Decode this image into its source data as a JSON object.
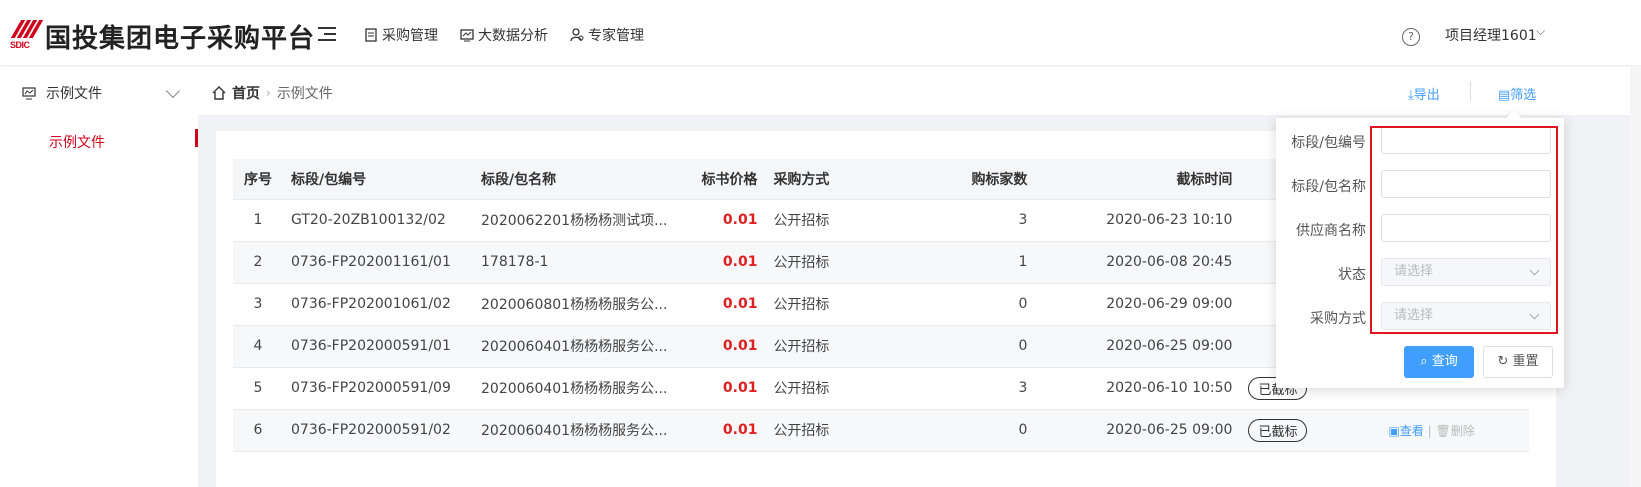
{
  "app": {
    "title": "国投集团电子采购平台",
    "logo_text": "SDIC"
  },
  "nav": [
    {
      "label": "采购管理",
      "icon": "document-icon"
    },
    {
      "label": "大数据分析",
      "icon": "chart-icon"
    },
    {
      "label": "专家管理",
      "icon": "people-icon"
    }
  ],
  "header": {
    "help": "?",
    "user": "项目经理1601"
  },
  "sidebar": {
    "group": "示例文件",
    "items": [
      {
        "label": "示例文件"
      }
    ]
  },
  "breadcrumb": {
    "home": "首页",
    "current": "示例文件"
  },
  "actions": {
    "export": "导出",
    "filter": "筛选"
  },
  "table": {
    "columns": [
      "序号",
      "标段/包编号",
      "标段/包名称",
      "标书价格",
      "采购方式",
      "购标家数",
      "截标时间"
    ],
    "rows": [
      {
        "no": "1",
        "code": "GT20-20ZB100132/02",
        "name": "2020062201杨杨杨测试项...",
        "price": "0.01",
        "method": "公开招标",
        "count": "3",
        "deadline": "2020-06-23 10:10",
        "status": "",
        "view": "",
        "del": ""
      },
      {
        "no": "2",
        "code": "0736-FP202001161/01",
        "name": "178178-1",
        "price": "0.01",
        "method": "公开招标",
        "count": "1",
        "deadline": "2020-06-08 20:45",
        "status": "",
        "view": "",
        "del": ""
      },
      {
        "no": "3",
        "code": "0736-FP202001061/02",
        "name": "2020060801杨杨杨服务公...",
        "price": "0.01",
        "method": "公开招标",
        "count": "0",
        "deadline": "2020-06-29 09:00",
        "status": "",
        "view": "",
        "del": ""
      },
      {
        "no": "4",
        "code": "0736-FP202000591/01",
        "name": "2020060401杨杨杨服务公...",
        "price": "0.01",
        "method": "公开招标",
        "count": "0",
        "deadline": "2020-06-25 09:00",
        "status": "",
        "view": "",
        "del": ""
      },
      {
        "no": "5",
        "code": "0736-FP202000591/09",
        "name": "2020060401杨杨杨服务公...",
        "price": "0.01",
        "method": "公开招标",
        "count": "3",
        "deadline": "2020-06-10 10:50",
        "status": "已截标",
        "view": "",
        "del": ""
      },
      {
        "no": "6",
        "code": "0736-FP202000591/02",
        "name": "2020060401杨杨杨服务公...",
        "price": "0.01",
        "method": "公开招标",
        "count": "0",
        "deadline": "2020-06-25 09:00",
        "status": "已截标",
        "view": "查看",
        "del": "删除"
      }
    ]
  },
  "filter": {
    "fields": [
      {
        "label": "标段/包编号",
        "value": ""
      },
      {
        "label": "标段/包名称",
        "value": ""
      },
      {
        "label": "供应商名称",
        "value": ""
      }
    ],
    "status_label": "状态",
    "status_placeholder": "请选择",
    "method_label": "采购方式",
    "method_placeholder": "请选择",
    "query": "查询",
    "reset": "重置"
  },
  "colors": {
    "brand": "#d0021b",
    "accent": "#409eff",
    "price": "#e02020",
    "highlight_box": "#e0161e"
  }
}
